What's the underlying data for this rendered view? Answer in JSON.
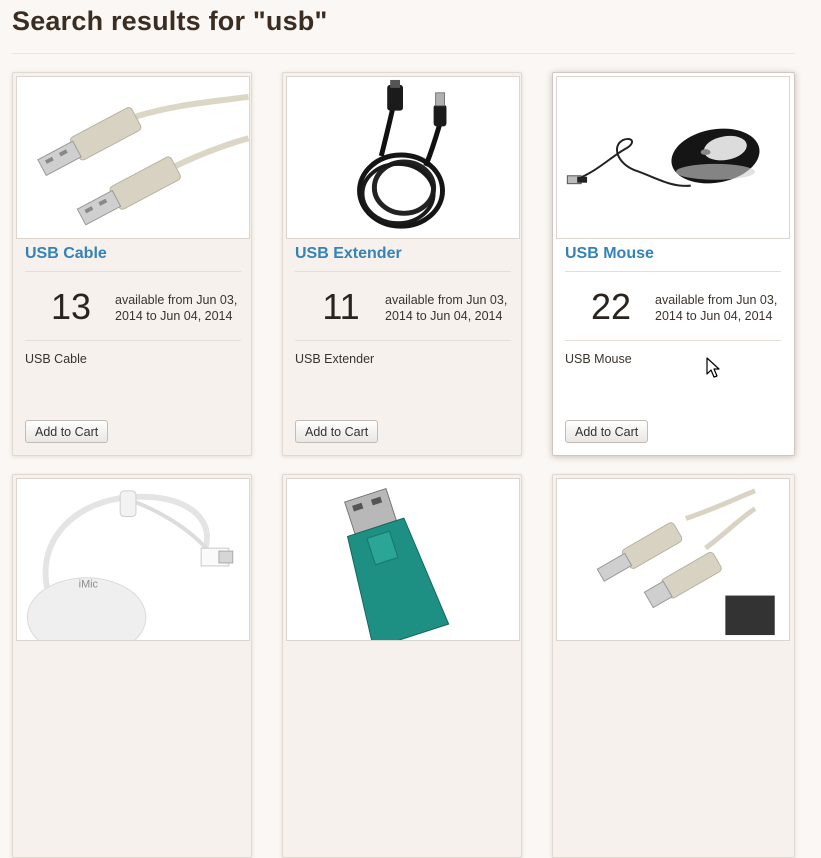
{
  "page": {
    "title": "Search results for \"usb\""
  },
  "products": [
    {
      "name": "USB Cable",
      "quantity": "13",
      "availability": "available from Jun 03, 2014 to Jun 04, 2014",
      "description": "USB Cable",
      "button": "Add to Cart"
    },
    {
      "name": "USB Extender",
      "quantity": "11",
      "availability": "available from Jun 03, 2014 to Jun 04, 2014",
      "description": "USB Extender",
      "button": "Add to Cart"
    },
    {
      "name": "USB Mouse",
      "quantity": "22",
      "availability": "available from Jun 03, 2014 to Jun 04, 2014",
      "description": "USB Mouse",
      "button": "Add to Cart"
    }
  ],
  "colors": {
    "link": "#3582b8",
    "background": "#fbf7f4",
    "title": "#3b2d22"
  },
  "icons": {
    "pointer": "mouse-cursor-icon"
  }
}
